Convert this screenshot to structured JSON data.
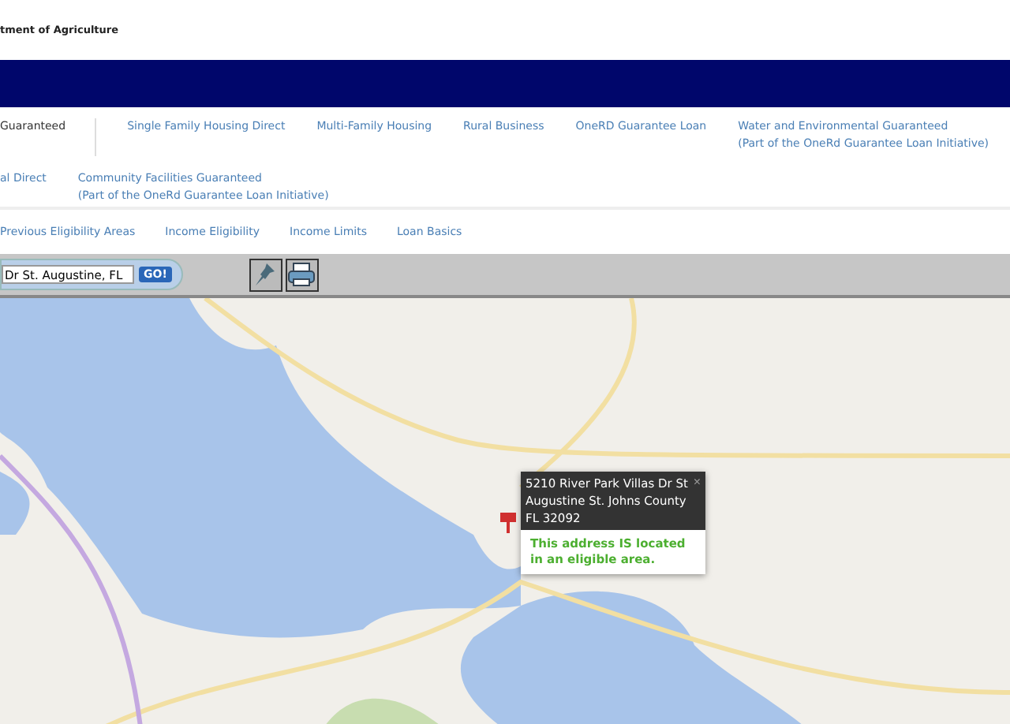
{
  "header": {
    "agency": "tment of Agriculture"
  },
  "nav_rows": [
    [
      {
        "label": "Guaranteed",
        "selected": true
      },
      {
        "label": "Single Family Housing Direct",
        "selected": false
      },
      {
        "label": "Multi-Family Housing",
        "selected": false
      },
      {
        "label": "Rural Business",
        "selected": false
      },
      {
        "label": "OneRD Guarantee Loan",
        "selected": false
      },
      {
        "label": "Water and Environmental Guaranteed",
        "note": "(Part of the OneRd Guarantee Loan Initiative)",
        "selected": false
      }
    ],
    [
      {
        "label": "al Direct",
        "selected": false
      },
      {
        "label": "Community Facilities Guaranteed",
        "note": "(Part of the OneRd Guarantee Loan Initiative)",
        "selected": false
      }
    ]
  ],
  "sub_links": [
    "Previous Eligibility Areas",
    "Income Eligibility",
    "Income Limits",
    "Loan Basics"
  ],
  "toolbar": {
    "address": "Dr St. Augustine, FL",
    "go": "GO!"
  },
  "map": {
    "popup": {
      "address": "5210 River Park Villas Dr St Augustine St. Johns County FL 32092",
      "close": "×",
      "result": "This address IS located in an eligible area."
    }
  }
}
